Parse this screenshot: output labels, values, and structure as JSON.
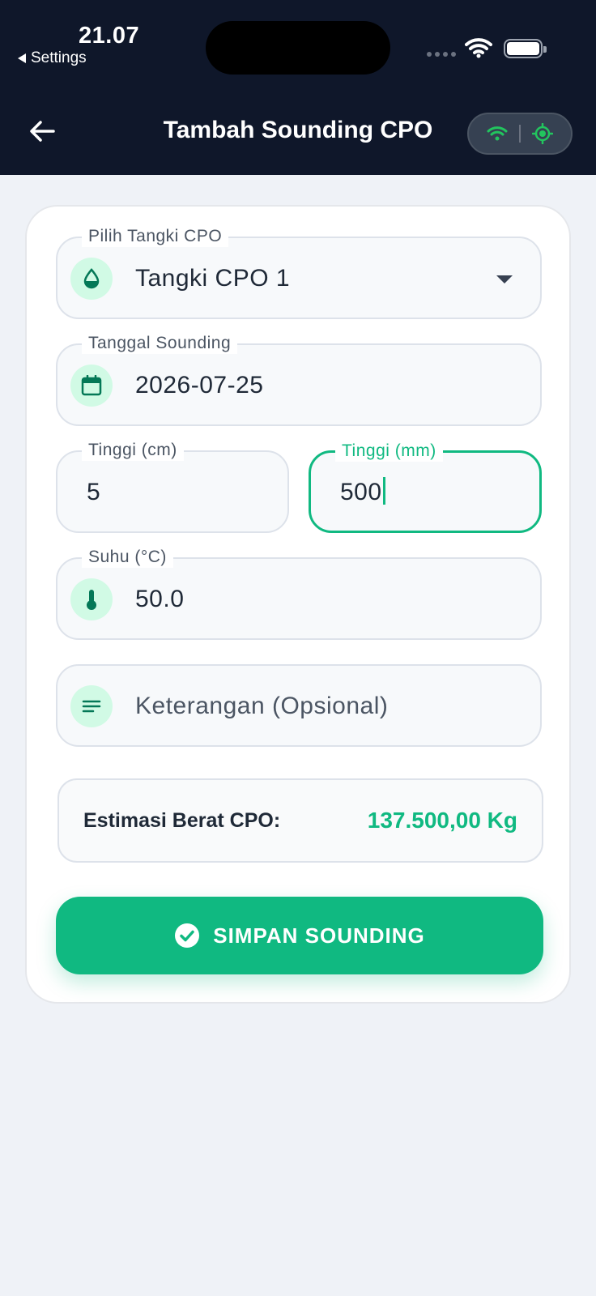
{
  "status_bar": {
    "time": "21.07",
    "back_label": "Settings"
  },
  "header": {
    "title": "Tambah Sounding CPO"
  },
  "form": {
    "tank": {
      "label": "Pilih Tangki CPO",
      "value": "Tangki CPO 1"
    },
    "date": {
      "label": "Tanggal Sounding",
      "value": "2026-07-25"
    },
    "height_cm": {
      "label": "Tinggi (cm)",
      "value": "5"
    },
    "height_mm": {
      "label": "Tinggi (mm)",
      "value": "500"
    },
    "temperature": {
      "label": "Suhu (°C)",
      "value": "50.0"
    },
    "note": {
      "placeholder": "Keterangan (Opsional)"
    },
    "estimate": {
      "label": "Estimasi Berat CPO:",
      "value": "137.500,00 Kg"
    },
    "save_label": "SIMPAN SOUNDING"
  },
  "colors": {
    "accent": "#10b981",
    "header_bg": "#0f172a",
    "page_bg": "#eff2f7"
  },
  "icons": [
    "chevron-left-icon",
    "wifi-icon",
    "gps-icon",
    "water-drop-icon",
    "calendar-icon",
    "thermometer-icon",
    "notes-icon",
    "check-circle-icon",
    "dropdown-arrow-icon"
  ]
}
